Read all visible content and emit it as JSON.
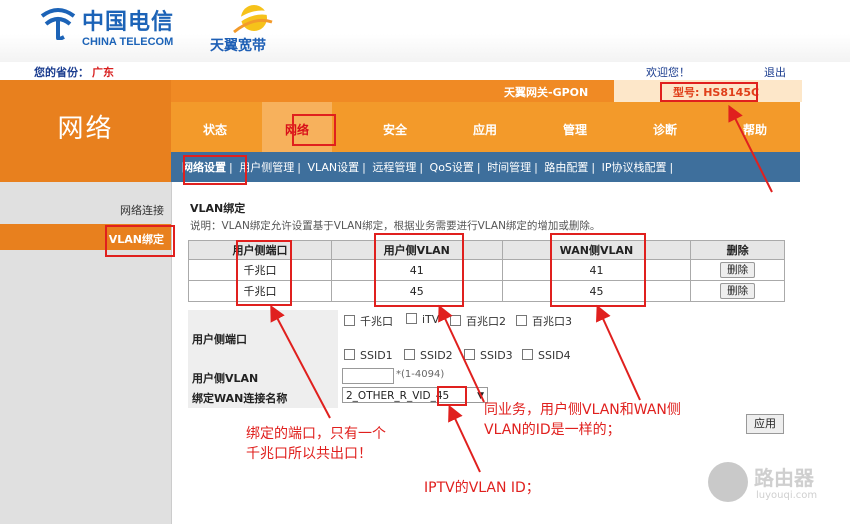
{
  "header": {
    "logo_cn": "中国电信",
    "logo_en": "CHINA TELECOM",
    "brand2": "天翼宽带",
    "province_label": "您的省份：",
    "province_value": "广东",
    "welcome": "欢迎您！",
    "logout": "退出",
    "gateway_name": "天翼网关-GPON",
    "model": "型号: HS8145C"
  },
  "section_title": "网络",
  "nav": [
    "状态",
    "网络",
    "安全",
    "应用",
    "管理",
    "诊断",
    "帮助"
  ],
  "subnav": [
    "网络设置",
    "用户侧管理",
    "VLAN设置",
    "远程管理",
    "QoS设置",
    "时间管理",
    "路由配置",
    "IP协议栈配置"
  ],
  "left_menu": [
    "网络连接",
    "VLAN绑定"
  ],
  "content": {
    "title": "VLAN绑定",
    "description": "说明：VLAN绑定允许设置基于VLAN绑定，根据业务需要进行VLAN绑定的增加或删除。",
    "table_headers": [
      "用户侧端口",
      "用户侧VLAN",
      "WAN侧VLAN",
      "删除"
    ],
    "rows": [
      {
        "port": "千兆口",
        "user_vlan": "41",
        "wan_vlan": "41",
        "del": "删除"
      },
      {
        "port": "千兆口",
        "user_vlan": "45",
        "wan_vlan": "45",
        "del": "删除"
      }
    ],
    "form": {
      "port_label": "用户侧端口",
      "ports": [
        "千兆口",
        "iTV",
        "百兆口2",
        "百兆口3"
      ],
      "ssids": [
        "SSID1",
        "SSID2",
        "SSID3",
        "SSID4"
      ],
      "user_vlan_label": "用户侧VLAN",
      "user_vlan_value": "",
      "user_vlan_hint": "*(1-4094)",
      "wan_label": "绑定WAN连接名称",
      "wan_value": "2_OTHER_R_VID_45",
      "apply": "应用"
    }
  },
  "annotations": {
    "port_note_1": "绑定的端口，只有一个",
    "port_note_2": "千兆口所以共出口！",
    "vlan_note_1": "同业务，用户侧VLAN和WAN侧",
    "vlan_note_2": "VLAN的ID是一样的；",
    "iptv_note": "IPTV的VLAN ID；"
  },
  "watermark": {
    "name": "路由器",
    "url": "luyouqi.com"
  },
  "colors": {
    "orange": "#e8801e",
    "nav": "#f39a2a",
    "subnav": "#3e6f9c",
    "annotation": "#e0201e",
    "brand_blue": "#1c63b7"
  }
}
